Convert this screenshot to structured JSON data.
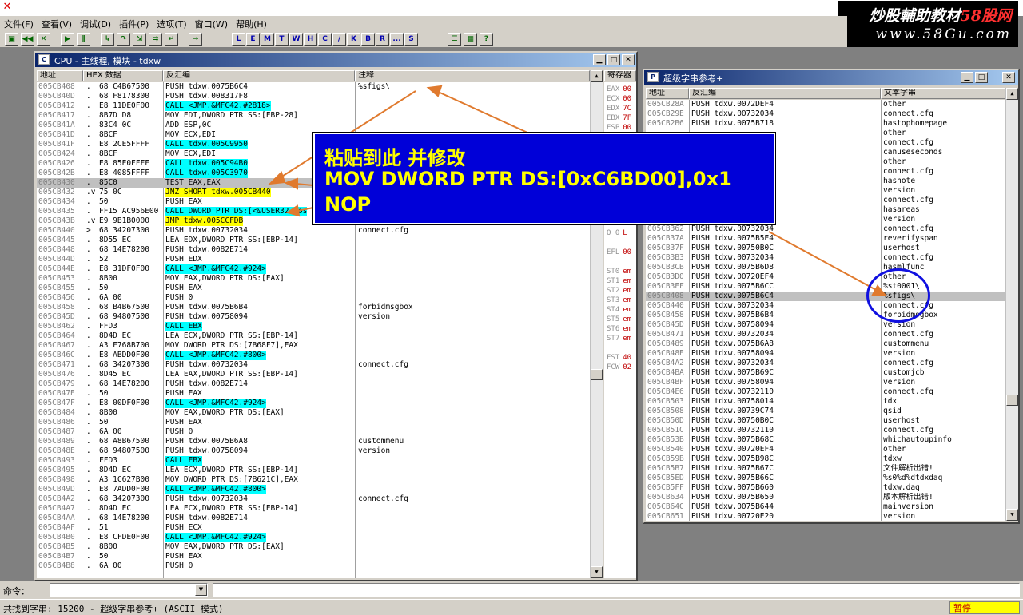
{
  "menu": [
    "文件(F)",
    "查看(V)",
    "调试(D)",
    "插件(P)",
    "选项(T)",
    "窗口(W)",
    "帮助(H)"
  ],
  "watermark": {
    "line1a": "炒股輔助教材",
    "line1b": "58股网",
    "line2": "www.58Gu.com"
  },
  "toolbar": {
    "icons": [
      "open-icon",
      "rewind-icon",
      "close-icon",
      "run-icon",
      "pause-icon",
      "step-into-icon",
      "step-over-icon",
      "trace-into-icon",
      "trace-over-icon",
      "execute-till-return-icon",
      "goto-icon"
    ],
    "letters": [
      "L",
      "E",
      "M",
      "T",
      "W",
      "H",
      "C",
      "/",
      "K",
      "B",
      "R",
      "...",
      "S"
    ],
    "extra_icons": [
      "list-icon",
      "grid-icon",
      "help-icon"
    ]
  },
  "cpu": {
    "title": "CPU - 主线程, 模块 - tdxw",
    "headers": {
      "addr": "地址",
      "hex": "HEX 数据",
      "disasm": "反汇编",
      "comment": "注释"
    },
    "rows": [
      {
        "a": "005CB408",
        "m": ".",
        "h": "68 C4B67500",
        "d": "PUSH tdxw.0075B6C4",
        "c": "%sfigs\\",
        "hl": ""
      },
      {
        "a": "005CB40D",
        "m": ".",
        "h": "68 F8178300",
        "d": "PUSH tdxw.008317F8",
        "c": "",
        "hl": ""
      },
      {
        "a": "005CB412",
        "m": ".",
        "h": "E8 11DE0F00",
        "d": "CALL <JMP.&MFC42.#2818>",
        "c": "",
        "hl": "cyan"
      },
      {
        "a": "005CB417",
        "m": ".",
        "h": "8B7D D8",
        "d": "MOV EDI,DWORD PTR SS:[EBP-28]",
        "c": "",
        "hl": ""
      },
      {
        "a": "005CB41A",
        "m": ".",
        "h": "83C4 0C",
        "d": "ADD ESP,0C",
        "c": "",
        "hl": ""
      },
      {
        "a": "005CB41D",
        "m": ".",
        "h": "8BCF",
        "d": "MOV ECX,EDI",
        "c": "",
        "hl": ""
      },
      {
        "a": "005CB41F",
        "m": ".",
        "h": "E8 2CE5FFFF",
        "d": "CALL tdxw.005C9950",
        "c": "",
        "hl": "cyan"
      },
      {
        "a": "005CB424",
        "m": ".",
        "h": "8BCF",
        "d": "MOV ECX,EDI",
        "c": "",
        "hl": ""
      },
      {
        "a": "005CB426",
        "m": ".",
        "h": "E8 85E0FFFF",
        "d": "CALL tdxw.005C94B0",
        "c": "",
        "hl": "cyan"
      },
      {
        "a": "005CB42B",
        "m": ".",
        "h": "E8 4085FFFF",
        "d": "CALL tdxw.005C3970",
        "c": "",
        "hl": "cyan"
      },
      {
        "a": "005CB430",
        "m": ".",
        "h": "85C0",
        "d": "TEST EAX,EAX",
        "c": "",
        "hl": "sel"
      },
      {
        "a": "005CB432",
        "m": ".v",
        "h": "75 0C",
        "d": "JNZ SHORT tdxw.005CB440",
        "c": "",
        "hl": "yellow"
      },
      {
        "a": "005CB434",
        "m": ".",
        "h": "50",
        "d": "PUSH EAX",
        "c": "",
        "hl": ""
      },
      {
        "a": "005CB435",
        "m": ".",
        "h": "FF15 AC956E00",
        "d": "CALL DWORD PTR DS:[<&USER32.Pos",
        "c": "",
        "hl": "cyan"
      },
      {
        "a": "005CB43B",
        "m": ".v",
        "h": "E9 9B1B0000",
        "d": "JMP tdxw.005CCFDB",
        "c": "",
        "hl": "yellow"
      },
      {
        "a": "005CB440",
        "m": ">",
        "h": "68 34207300",
        "d": "PUSH tdxw.00732034",
        "c": "connect.cfg",
        "hl": ""
      },
      {
        "a": "005CB445",
        "m": ".",
        "h": "8D55 EC",
        "d": "LEA EDX,DWORD PTR SS:[EBP-14]",
        "c": "",
        "hl": ""
      },
      {
        "a": "005CB448",
        "m": ".",
        "h": "68 14E78200",
        "d": "PUSH tdxw.0082E714",
        "c": "",
        "hl": ""
      },
      {
        "a": "005CB44D",
        "m": ".",
        "h": "52",
        "d": "PUSH EDX",
        "c": "",
        "hl": ""
      },
      {
        "a": "005CB44E",
        "m": ".",
        "h": "E8 31DF0F00",
        "d": "CALL <JMP.&MFC42.#924>",
        "c": "",
        "hl": "cyan"
      },
      {
        "a": "005CB453",
        "m": ".",
        "h": "8B00",
        "d": "MOV EAX,DWORD PTR DS:[EAX]",
        "c": "",
        "hl": ""
      },
      {
        "a": "005CB455",
        "m": ".",
        "h": "50",
        "d": "PUSH EAX",
        "c": "",
        "hl": ""
      },
      {
        "a": "005CB456",
        "m": ".",
        "h": "6A 00",
        "d": "PUSH 0",
        "c": "",
        "hl": ""
      },
      {
        "a": "005CB458",
        "m": ".",
        "h": "68 B4B67500",
        "d": "PUSH tdxw.0075B6B4",
        "c": "forbidmsgbox",
        "hl": ""
      },
      {
        "a": "005CB45D",
        "m": ".",
        "h": "68 94807500",
        "d": "PUSH tdxw.00758094",
        "c": "version",
        "hl": ""
      },
      {
        "a": "005CB462",
        "m": ".",
        "h": "FFD3",
        "d": "CALL EBX",
        "c": "",
        "hl": "cyan"
      },
      {
        "a": "005CB464",
        "m": ".",
        "h": "8D4D EC",
        "d": "LEA ECX,DWORD PTR SS:[EBP-14]",
        "c": "",
        "hl": ""
      },
      {
        "a": "005CB467",
        "m": ".",
        "h": "A3 F768B700",
        "d": "MOV DWORD PTR DS:[7B68F7],EAX",
        "c": "",
        "hl": ""
      },
      {
        "a": "005CB46C",
        "m": ".",
        "h": "E8 ABDD0F00",
        "d": "CALL <JMP.&MFC42.#800>",
        "c": "",
        "hl": "cyan"
      },
      {
        "a": "005CB471",
        "m": ".",
        "h": "68 34207300",
        "d": "PUSH tdxw.00732034",
        "c": "connect.cfg",
        "hl": ""
      },
      {
        "a": "005CB476",
        "m": ".",
        "h": "8D45 EC",
        "d": "LEA EAX,DWORD PTR SS:[EBP-14]",
        "c": "",
        "hl": ""
      },
      {
        "a": "005CB479",
        "m": ".",
        "h": "68 14E78200",
        "d": "PUSH tdxw.0082E714",
        "c": "",
        "hl": ""
      },
      {
        "a": "005CB47E",
        "m": ".",
        "h": "50",
        "d": "PUSH EAX",
        "c": "",
        "hl": ""
      },
      {
        "a": "005CB47F",
        "m": ".",
        "h": "E8 00DF0F00",
        "d": "CALL <JMP.&MFC42.#924>",
        "c": "",
        "hl": "cyan"
      },
      {
        "a": "005CB484",
        "m": ".",
        "h": "8B00",
        "d": "MOV EAX,DWORD PTR DS:[EAX]",
        "c": "",
        "hl": ""
      },
      {
        "a": "005CB486",
        "m": ".",
        "h": "50",
        "d": "PUSH EAX",
        "c": "",
        "hl": ""
      },
      {
        "a": "005CB487",
        "m": ".",
        "h": "6A 00",
        "d": "PUSH 0",
        "c": "",
        "hl": ""
      },
      {
        "a": "005CB489",
        "m": ".",
        "h": "68 A8B67500",
        "d": "PUSH tdxw.0075B6A8",
        "c": "custommenu",
        "hl": ""
      },
      {
        "a": "005CB48E",
        "m": ".",
        "h": "68 94807500",
        "d": "PUSH tdxw.00758094",
        "c": "version",
        "hl": ""
      },
      {
        "a": "005CB493",
        "m": ".",
        "h": "FFD3",
        "d": "CALL EBX",
        "c": "",
        "hl": "cyan"
      },
      {
        "a": "005CB495",
        "m": ".",
        "h": "8D4D EC",
        "d": "LEA ECX,DWORD PTR SS:[EBP-14]",
        "c": "",
        "hl": ""
      },
      {
        "a": "005CB498",
        "m": ".",
        "h": "A3 1C627B00",
        "d": "MOV DWORD PTR DS:[7B621C],EAX",
        "c": "",
        "hl": ""
      },
      {
        "a": "005CB49D",
        "m": ".",
        "h": "E8 7ADD0F00",
        "d": "CALL <JMP.&MFC42.#800>",
        "c": "",
        "hl": "cyan"
      },
      {
        "a": "005CB4A2",
        "m": ".",
        "h": "68 34207300",
        "d": "PUSH tdxw.00732034",
        "c": "connect.cfg",
        "hl": ""
      },
      {
        "a": "005CB4A7",
        "m": ".",
        "h": "8D4D EC",
        "d": "LEA ECX,DWORD PTR SS:[EBP-14]",
        "c": "",
        "hl": ""
      },
      {
        "a": "005CB4AA",
        "m": ".",
        "h": "68 14E78200",
        "d": "PUSH tdxw.0082E714",
        "c": "",
        "hl": ""
      },
      {
        "a": "005CB4AF",
        "m": ".",
        "h": "51",
        "d": "PUSH ECX",
        "c": "",
        "hl": ""
      },
      {
        "a": "005CB4B0",
        "m": ".",
        "h": "E8 CFDE0F00",
        "d": "CALL <JMP.&MFC42.#924>",
        "c": "",
        "hl": "cyan"
      },
      {
        "a": "005CB4B5",
        "m": ".",
        "h": "8B00",
        "d": "MOV EAX,DWORD PTR DS:[EAX]",
        "c": "",
        "hl": ""
      },
      {
        "a": "005CB4B7",
        "m": ".",
        "h": "50",
        "d": "PUSH EAX",
        "c": "",
        "hl": ""
      },
      {
        "a": "005CB4B8",
        "m": ".",
        "h": "6A 00",
        "d": "PUSH 0",
        "c": "",
        "hl": ""
      }
    ]
  },
  "registers": {
    "title": "寄存器",
    "rows": [
      {
        "n": "EAX",
        "v": "00"
      },
      {
        "n": "ECX",
        "v": "00"
      },
      {
        "n": "EDX",
        "v": "7C"
      },
      {
        "n": "EBX",
        "v": "7F"
      },
      {
        "n": "ESP",
        "v": "00"
      },
      {
        "n": "",
        "v": ""
      },
      {
        "n": "",
        "v": ""
      },
      {
        "n": "",
        "v": ""
      },
      {
        "n": "",
        "v": ""
      },
      {
        "n": "",
        "v": ""
      },
      {
        "n": "",
        "v": ""
      },
      {
        "n": "",
        "v": ""
      },
      {
        "n": "",
        "v": ""
      },
      {
        "n": "T 0",
        "v": "G"
      },
      {
        "n": "D 0",
        "v": ""
      },
      {
        "n": "O 0",
        "v": "L"
      },
      {
        "n": "",
        "v": ""
      },
      {
        "n": "EFL",
        "v": "00"
      },
      {
        "n": "",
        "v": ""
      },
      {
        "n": "ST0",
        "v": "em"
      },
      {
        "n": "ST1",
        "v": "em"
      },
      {
        "n": "ST2",
        "v": "em"
      },
      {
        "n": "ST3",
        "v": "em"
      },
      {
        "n": "ST4",
        "v": "em"
      },
      {
        "n": "ST5",
        "v": "em"
      },
      {
        "n": "ST6",
        "v": "em"
      },
      {
        "n": "ST7",
        "v": "em"
      },
      {
        "n": "",
        "v": ""
      },
      {
        "n": "FST",
        "v": "40"
      },
      {
        "n": "FCW",
        "v": "02"
      }
    ]
  },
  "strings": {
    "title": "超级字串参考+",
    "headers": {
      "addr": "地址",
      "disasm": "反汇编",
      "text": "文本字串"
    },
    "rows": [
      {
        "a": "005CB28A",
        "d": "PUSH tdxw.0072DEF4",
        "t": "other"
      },
      {
        "a": "005CB29E",
        "d": "PUSH tdxw.00732034",
        "t": "connect.cfg"
      },
      {
        "a": "005CB2B6",
        "d": "PUSH tdxw.0075B718",
        "t": "hastophomepage"
      },
      {
        "a": "",
        "d": "",
        "t": "other"
      },
      {
        "a": "",
        "d": "",
        "t": "connect.cfg"
      },
      {
        "a": "",
        "d": "",
        "t": "canuseseconds"
      },
      {
        "a": "",
        "d": "",
        "t": "other"
      },
      {
        "a": "",
        "d": "",
        "t": "connect.cfg"
      },
      {
        "a": "",
        "d": "",
        "t": "hasnote"
      },
      {
        "a": "",
        "d": "",
        "t": "version"
      },
      {
        "a": "",
        "d": "",
        "t": "connect.cfg"
      },
      {
        "a": "",
        "d": "",
        "t": "hasareas"
      },
      {
        "a": "",
        "d": "",
        "t": "version"
      },
      {
        "a": "005CB362",
        "d": "PUSH tdxw.00732034",
        "t": "connect.cfg"
      },
      {
        "a": "005CB37A",
        "d": "PUSH tdxw.0075B5E4",
        "t": "reverifyspan"
      },
      {
        "a": "005CB37F",
        "d": "PUSH tdxw.00750B0C",
        "t": "userhost"
      },
      {
        "a": "005CB3B3",
        "d": "PUSH tdxw.00732034",
        "t": "connect.cfg"
      },
      {
        "a": "005CB3CB",
        "d": "PUSH tdxw.0075B6D8",
        "t": "hasmlfunc"
      },
      {
        "a": "005CB3D0",
        "d": "PUSH tdxw.00720EF4",
        "t": "other"
      },
      {
        "a": "005CB3EF",
        "d": "PUSH tdxw.0075B6CC",
        "t": "%st0001\\"
      },
      {
        "a": "005CB408",
        "d": "PUSH tdxw.0075B6C4",
        "t": "%sfigs\\",
        "sel": true
      },
      {
        "a": "005CB440",
        "d": "PUSH tdxw.00732034",
        "t": "connect.cfg"
      },
      {
        "a": "005CB458",
        "d": "PUSH tdxw.0075B6B4",
        "t": "forbidmsgbox"
      },
      {
        "a": "005CB45D",
        "d": "PUSH tdxw.00758094",
        "t": "version"
      },
      {
        "a": "005CB471",
        "d": "PUSH tdxw.00732034",
        "t": "connect.cfg"
      },
      {
        "a": "005CB489",
        "d": "PUSH tdxw.0075B6A8",
        "t": "custommenu"
      },
      {
        "a": "005CB48E",
        "d": "PUSH tdxw.00758094",
        "t": "version"
      },
      {
        "a": "005CB4A2",
        "d": "PUSH tdxw.00732034",
        "t": "connect.cfg"
      },
      {
        "a": "005CB4BA",
        "d": "PUSH tdxw.0075B69C",
        "t": "customjcb"
      },
      {
        "a": "005CB4BF",
        "d": "PUSH tdxw.00758094",
        "t": "version"
      },
      {
        "a": "005CB4E6",
        "d": "PUSH tdxw.00732110",
        "t": "connect.cfg"
      },
      {
        "a": "005CB503",
        "d": "PUSH tdxw.00758014",
        "t": "tdx"
      },
      {
        "a": "005CB508",
        "d": "PUSH tdxw.00739C74",
        "t": "qsid"
      },
      {
        "a": "005CB50D",
        "d": "PUSH tdxw.00750B0C",
        "t": "userhost"
      },
      {
        "a": "005CB51C",
        "d": "PUSH tdxw.00732110",
        "t": "connect.cfg"
      },
      {
        "a": "005CB53B",
        "d": "PUSH tdxw.0075B68C",
        "t": "whichautoupinfo"
      },
      {
        "a": "005CB540",
        "d": "PUSH tdxw.00720EF4",
        "t": "other"
      },
      {
        "a": "005CB59B",
        "d": "PUSH tdxw.0075B98C",
        "t": "tdxw"
      },
      {
        "a": "005CB5B7",
        "d": "PUSH tdxw.0075B67C",
        "t": "文件解析出错!"
      },
      {
        "a": "005CB5ED",
        "d": "PUSH tdxw.0075B66C",
        "t": "%s0%d%dtdxdaq"
      },
      {
        "a": "005CB5FF",
        "d": "PUSH tdxw.0075B660",
        "t": "tdxw.daq"
      },
      {
        "a": "005CB634",
        "d": "PUSH tdxw.0075B650",
        "t": "版本解析出错!"
      },
      {
        "a": "005CB64C",
        "d": "PUSH tdxw.0075B644",
        "t": "mainversion"
      },
      {
        "a": "005CB651",
        "d": "PUSH tdxw.00720E20",
        "t": "version"
      }
    ]
  },
  "annotation": {
    "line1": "粘贴到此 并修改",
    "line2": "MOV DWORD PTR DS:[0xC6BD00],0x1",
    "line3": "NOP"
  },
  "command": {
    "label": "命令：",
    "value": ""
  },
  "status": {
    "text": "共找到字串: 15200 - 超级字串参考+ (ASCII 模式)",
    "state": "暂停"
  }
}
